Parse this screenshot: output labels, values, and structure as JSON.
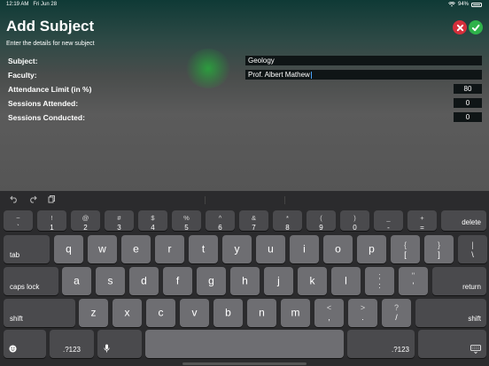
{
  "status": {
    "time": "12:19 AM",
    "date": "Fri Jun 28",
    "battery": "94%"
  },
  "page": {
    "title": "Add Subject",
    "subtitle": "Enter the details for new subject"
  },
  "colors": {
    "cancel": "#d42f3b",
    "confirm": "#2eb24a",
    "caret": "#4aa3ff"
  },
  "form": {
    "subject_label": "Subject:",
    "subject_value": "Geology",
    "faculty_label": "Faculty:",
    "faculty_value": "Prof. Albert Mathew",
    "attendance_label": "Attendance Limit (in %)",
    "attendance_value": "80",
    "attended_label": "Sessions Attended:",
    "attended_value": "0",
    "conducted_label": "Sessions Conducted:",
    "conducted_value": "0"
  },
  "keyboard": {
    "assistant_icons": [
      "undo-icon",
      "redo-icon",
      "paste-icon"
    ],
    "row1": [
      {
        "top": "~",
        "bot": "`"
      },
      {
        "top": "!",
        "bot": "1"
      },
      {
        "top": "@",
        "bot": "2"
      },
      {
        "top": "#",
        "bot": "3"
      },
      {
        "top": "$",
        "bot": "4"
      },
      {
        "top": "%",
        "bot": "5"
      },
      {
        "top": "^",
        "bot": "6"
      },
      {
        "top": "&",
        "bot": "7"
      },
      {
        "top": "*",
        "bot": "8"
      },
      {
        "top": "(",
        "bot": "9"
      },
      {
        "top": ")",
        "bot": "0"
      },
      {
        "top": "_",
        "bot": "-"
      },
      {
        "top": "+",
        "bot": "="
      }
    ],
    "delete": "delete",
    "tab": "tab",
    "row2": [
      "q",
      "w",
      "e",
      "r",
      "t",
      "y",
      "u",
      "i",
      "o",
      "p"
    ],
    "row2_extra": [
      {
        "top": "{",
        "bot": "["
      },
      {
        "top": "}",
        "bot": "]"
      },
      {
        "top": "|",
        "bot": "\\"
      }
    ],
    "caps_lock": "caps lock",
    "row3": [
      "a",
      "s",
      "d",
      "f",
      "g",
      "h",
      "j",
      "k",
      "l"
    ],
    "row3_extra": [
      {
        "top": ";",
        "bot": ":"
      },
      {
        "top": "\"",
        "bot": "'"
      }
    ],
    "return": "return",
    "shift": "shift",
    "row4": [
      "z",
      "x",
      "c",
      "v",
      "b",
      "n",
      "m"
    ],
    "row4_extra": [
      {
        "top": "<",
        "bot": ","
      },
      {
        "top": ">",
        "bot": "."
      },
      {
        "top": "?",
        "bot": "/"
      }
    ],
    "numbers": ".?123",
    "emoji_icon": "emoji-icon",
    "mic_icon": "microphone-icon",
    "hide_icon": "keyboard-dismiss-icon"
  }
}
